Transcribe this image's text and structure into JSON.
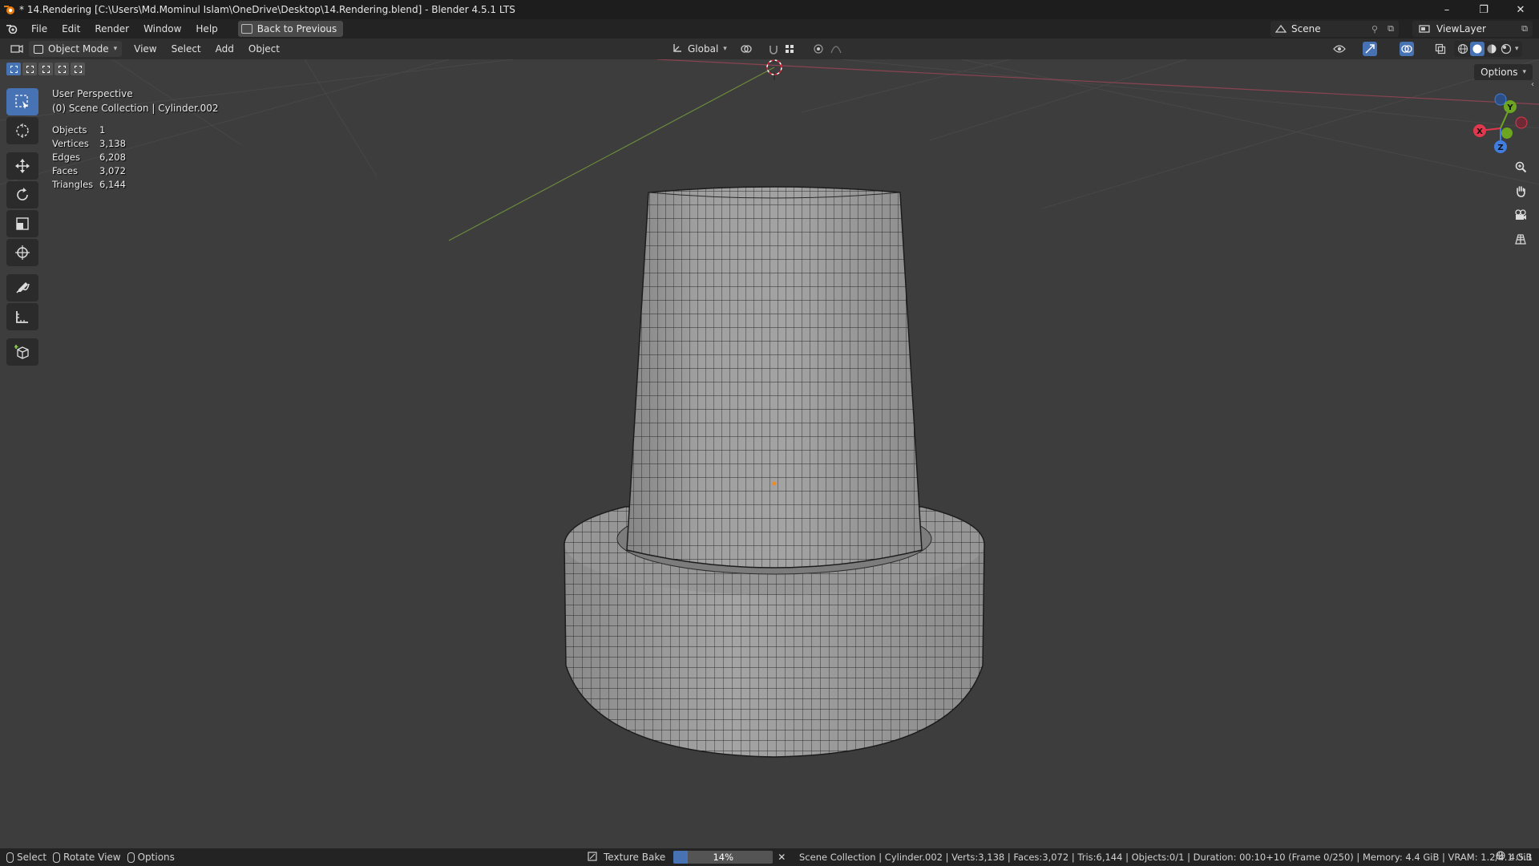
{
  "window": {
    "title": "* 14.Rendering [C:\\Users\\Md.Mominul Islam\\OneDrive\\Desktop\\14.Rendering.blend] - Blender 4.5.1 LTS",
    "controls": [
      "–",
      "❐",
      "✕"
    ]
  },
  "menubar": {
    "items": [
      "File",
      "Edit",
      "Render",
      "Window",
      "Help"
    ],
    "back_button": "Back to Previous",
    "scene": "Scene",
    "view_layer": "ViewLayer"
  },
  "viewport_header": {
    "mode": "Object Mode",
    "menus": [
      "View",
      "Select",
      "Add",
      "Object"
    ],
    "orientation": "Global"
  },
  "viewport": {
    "perspective": "User Perspective",
    "collection": "(0) Scene Collection | Cylinder.002",
    "options": "Options",
    "stats": [
      {
        "label": "Objects",
        "value": "1"
      },
      {
        "label": "Vertices",
        "value": "3,138"
      },
      {
        "label": "Edges",
        "value": "6,208"
      },
      {
        "label": "Faces",
        "value": "3,072"
      },
      {
        "label": "Triangles",
        "value": "6,144"
      }
    ],
    "gizmo_axes": {
      "x": "X",
      "y": "Y",
      "z": "Z"
    }
  },
  "tools": [
    "select-box-icon",
    "cursor-icon",
    "move-icon",
    "rotate-icon",
    "scale-icon",
    "transform-icon",
    "annotate-icon",
    "measure-icon",
    "add-cube-icon"
  ],
  "statusbar": {
    "select": "Select",
    "rotate_view": "Rotate View",
    "options": "Options",
    "job": "Texture Bake",
    "progress": 0.14,
    "progress_label": "14%",
    "info": "Scene Collection | Cylinder.002 | Verts:3,138 | Faces:3,072 | Tris:6,144 | Objects:0/1 | Duration: 00:10+10 (Frame 0/250) | Memory: 4.4 GiB | VRAM: 1.2/4.1 GiB",
    "version": "4.5.1"
  },
  "colors": {
    "accent": "#4772b3",
    "axis_x": "#e2384d",
    "axis_y": "#6ca520",
    "axis_z": "#3f7ee0"
  }
}
